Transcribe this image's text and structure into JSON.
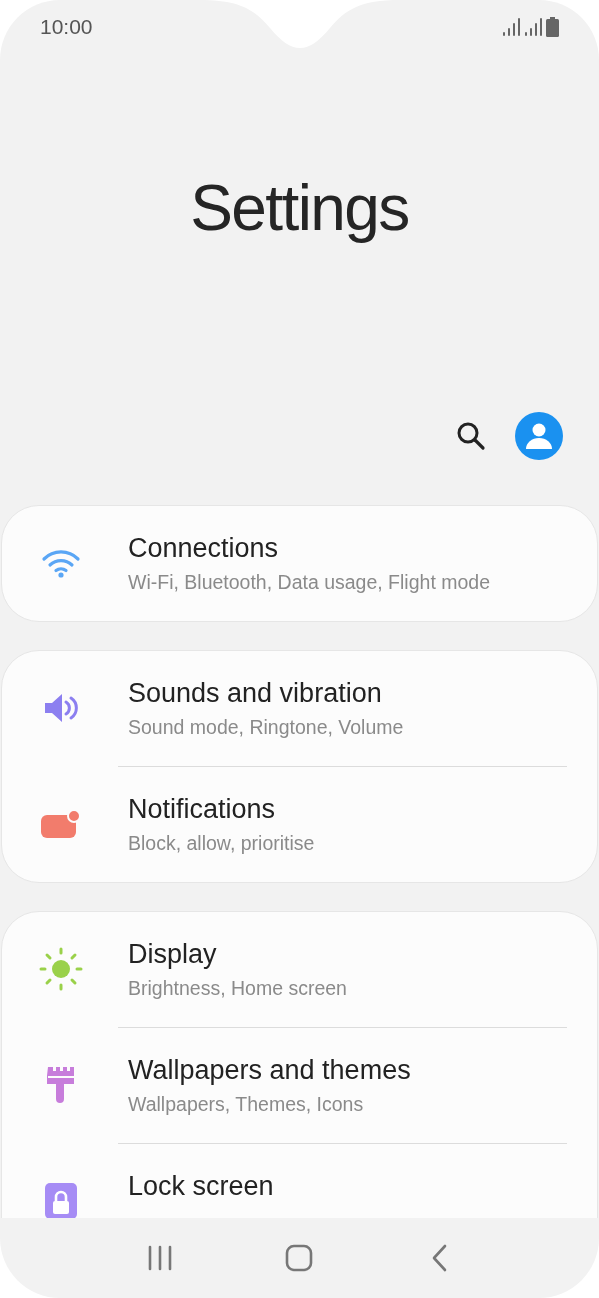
{
  "status_bar": {
    "time": "10:00"
  },
  "header": {
    "title": "Settings"
  },
  "groups": [
    {
      "items": [
        {
          "kind": "wifi",
          "title": "Connections",
          "subtitle": "Wi-Fi, Bluetooth, Data usage, Flight mode"
        }
      ]
    },
    {
      "items": [
        {
          "kind": "sound",
          "title": "Sounds and vibration",
          "subtitle": "Sound mode, Ringtone, Volume"
        },
        {
          "kind": "notification",
          "title": "Notifications",
          "subtitle": "Block, allow, prioritise"
        }
      ]
    },
    {
      "items": [
        {
          "kind": "display",
          "title": "Display",
          "subtitle": "Brightness, Home screen"
        },
        {
          "kind": "brush",
          "title": "Wallpapers and themes",
          "subtitle": "Wallpapers, Themes, Icons"
        },
        {
          "kind": "lock",
          "title": "Lock screen"
        }
      ]
    }
  ]
}
